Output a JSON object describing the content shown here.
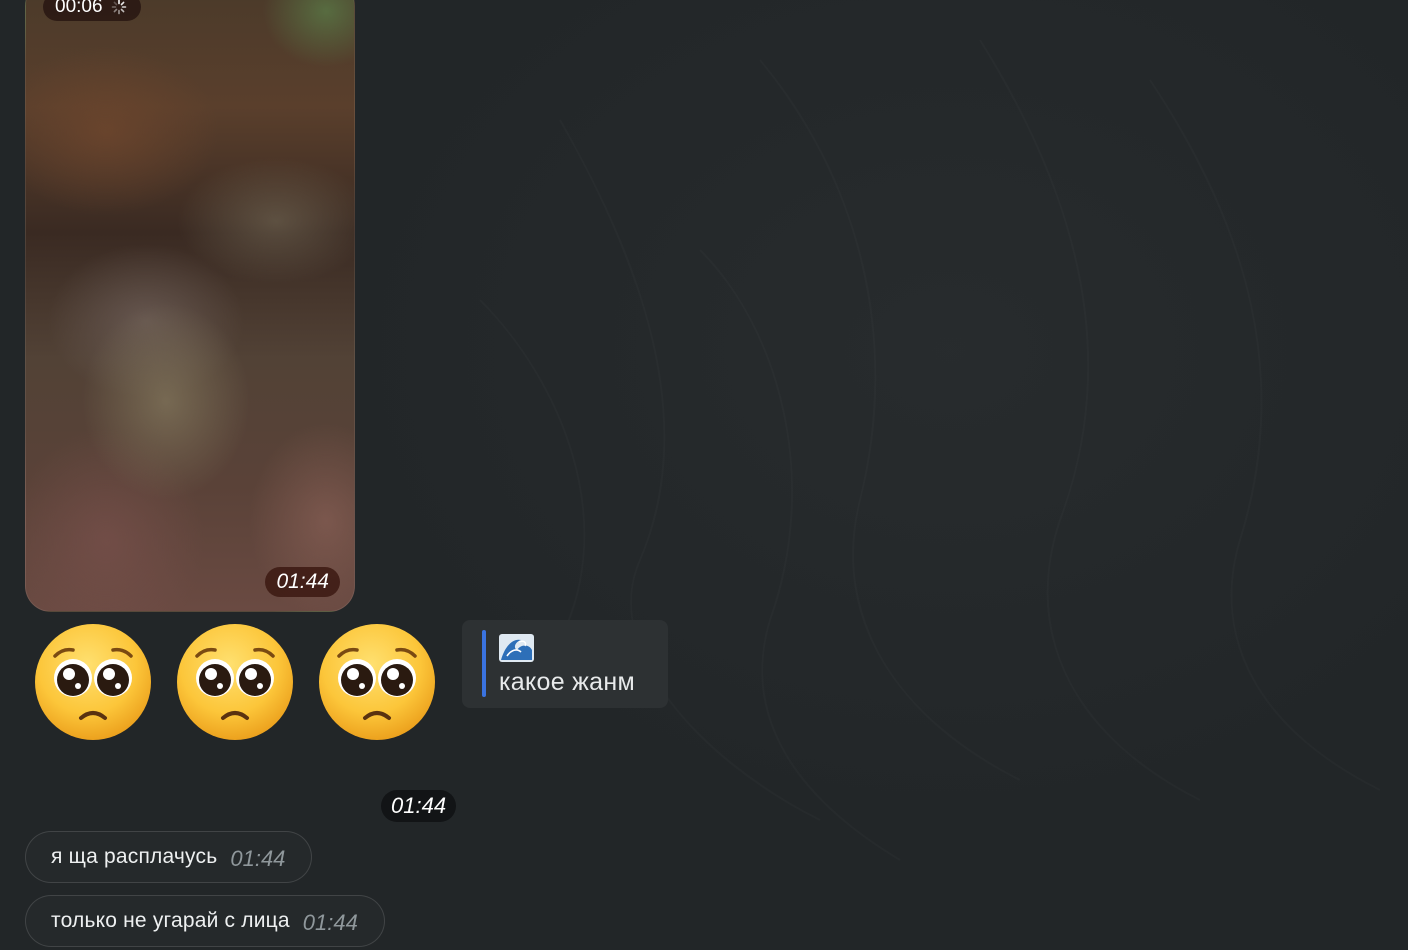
{
  "messages": {
    "video": {
      "duration": "00:06",
      "time": "01:44"
    },
    "emoji_message": {
      "emojis": [
        "pleading-face",
        "pleading-face",
        "pleading-face"
      ],
      "reply": {
        "emoji": "🌊",
        "text": "какое жанм"
      },
      "time": "01:44"
    },
    "text_messages": [
      {
        "text": "я ща расплачусь",
        "time": "01:44"
      },
      {
        "text": "только не угарай с лица",
        "time": "01:44"
      }
    ]
  },
  "colors": {
    "background": "#222628",
    "bubble": "#25292b",
    "reply_accent": "#3a73e0",
    "time_pill": "#121416"
  }
}
